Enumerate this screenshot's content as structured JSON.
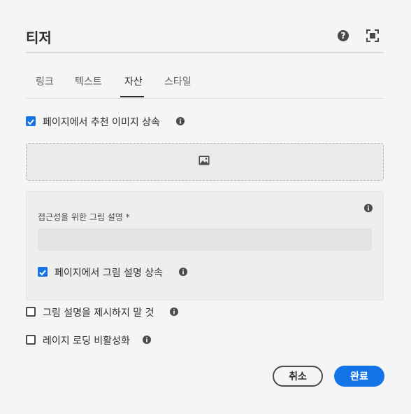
{
  "dialog": {
    "title": "티저",
    "tabs": [
      {
        "label": "링크"
      },
      {
        "label": "텍스트"
      },
      {
        "label": "자산",
        "active": true
      },
      {
        "label": "스타일"
      }
    ],
    "inherit_featured_image": {
      "label": "페이지에서 추천 이미지 상속",
      "checked": true
    },
    "image_placeholder_icon": "image-icon",
    "alt_text": {
      "label": "접근성을 위한 그림 설명 *",
      "value": "",
      "inherit_from_page": {
        "label": "페이지에서 그림 설명 상속",
        "checked": true
      }
    },
    "no_alt_text": {
      "label": "그림 설명을 제시하지 말 것",
      "checked": false
    },
    "lazy_loading_off": {
      "label": "레이지 로딩 비활성화",
      "checked": false
    },
    "buttons": {
      "cancel": "취소",
      "done": "완료"
    },
    "colors": {
      "accent": "#1473e6",
      "background": "#f5f5f5"
    }
  }
}
